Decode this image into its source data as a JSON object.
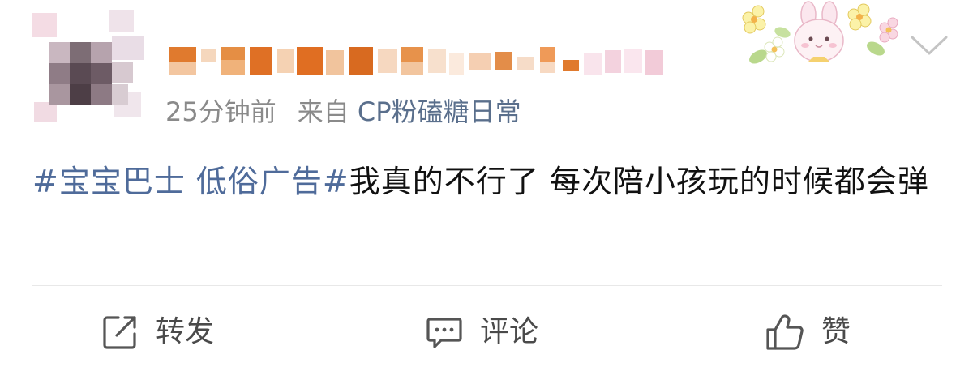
{
  "post": {
    "time": "25分钟前",
    "source_prefix": "来自",
    "source_name": "CP粉磕糖日常",
    "content": {
      "hashtag": "#宝宝巴士 低俗广告#",
      "text": "我真的不行了 每次陪小孩玩的时候都会弹"
    }
  },
  "actions": {
    "share_label": "转发",
    "comment_label": "评论",
    "like_label": "赞"
  },
  "icons": {
    "share": "share-icon",
    "comment": "comment-icon",
    "like": "thumbs-up-icon",
    "menu": "chevron-down-icon"
  },
  "colors": {
    "hashtag": "#4f6b9a",
    "meta_text": "#8a8a8a",
    "content_text": "#111111",
    "action_text": "#4a4a4a"
  }
}
